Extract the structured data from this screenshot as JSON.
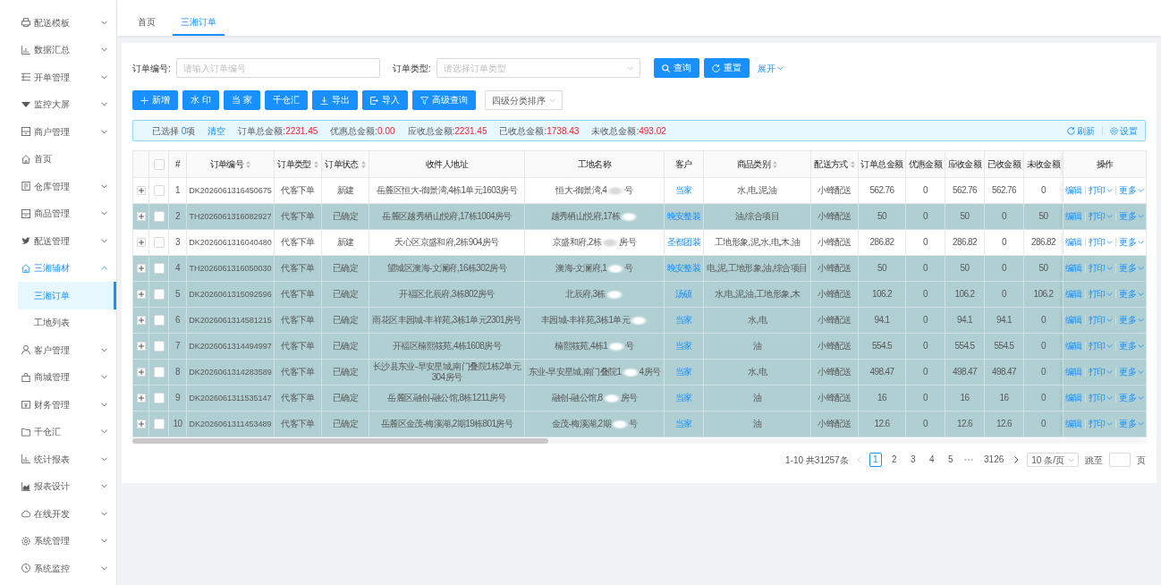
{
  "sidebar": {
    "items": [
      {
        "label": "配送模板",
        "kind": "group",
        "expanded": false,
        "selected": false
      },
      {
        "label": "数据汇总",
        "kind": "group",
        "expanded": false,
        "selected": false
      },
      {
        "label": "开单管理",
        "kind": "group",
        "expanded": false,
        "selected": false
      },
      {
        "label": "监控大屏",
        "kind": "group",
        "expanded": false,
        "selected": false
      },
      {
        "label": "商户管理",
        "kind": "group",
        "expanded": false,
        "selected": false
      },
      {
        "label": "首页",
        "kind": "link",
        "selected": false
      },
      {
        "label": "仓库管理",
        "kind": "group",
        "expanded": false,
        "selected": false
      },
      {
        "label": "商品管理",
        "kind": "group",
        "expanded": false,
        "selected": false
      },
      {
        "label": "配送管理",
        "kind": "group",
        "expanded": false,
        "selected": false
      },
      {
        "label": "三湘辅材",
        "kind": "group",
        "expanded": true,
        "selected": true,
        "children": [
          {
            "label": "三湘订单",
            "selected": true
          },
          {
            "label": "工地列表",
            "selected": false
          }
        ]
      },
      {
        "label": "客户管理",
        "kind": "group",
        "expanded": false,
        "selected": false
      },
      {
        "label": "商城管理",
        "kind": "group",
        "expanded": false,
        "selected": false
      },
      {
        "label": "财务管理",
        "kind": "group",
        "expanded": false,
        "selected": false
      },
      {
        "label": "千仓汇",
        "kind": "group",
        "expanded": false,
        "selected": false
      },
      {
        "label": "统计报表",
        "kind": "group",
        "expanded": false,
        "selected": false
      },
      {
        "label": "报表设计",
        "kind": "group",
        "expanded": false,
        "selected": false
      },
      {
        "label": "在线开发",
        "kind": "group",
        "expanded": false,
        "selected": false
      },
      {
        "label": "系统管理",
        "kind": "group",
        "expanded": false,
        "selected": false
      },
      {
        "label": "系统监控",
        "kind": "group",
        "expanded": false,
        "selected": false
      }
    ]
  },
  "tabs": [
    {
      "label": "首页",
      "selected": false
    },
    {
      "label": "三湘订单",
      "selected": true
    }
  ],
  "filters": {
    "fields": [
      {
        "kind": "input",
        "label": "订单编号:",
        "placeholder": "请输入订单编号"
      },
      {
        "kind": "select",
        "label": "订单类型:",
        "placeholder": "请选择订单类型"
      }
    ],
    "buttons": [
      {
        "kind": "search",
        "label": "查询"
      },
      {
        "kind": "reset",
        "label": "重置"
      }
    ],
    "expand_link": "展开"
  },
  "toolbar": {
    "buttons": [
      {
        "kind": "add",
        "label": "新增"
      },
      {
        "kind": "plain",
        "label": "水 印"
      },
      {
        "kind": "plain",
        "label": "当 家"
      },
      {
        "kind": "plain",
        "label": "千仓汇"
      },
      {
        "kind": "export",
        "label": "导出"
      },
      {
        "kind": "import",
        "label": "导入"
      },
      {
        "kind": "filter",
        "label": "高级查询"
      }
    ],
    "sort_select": {
      "value": "四级分类排序"
    }
  },
  "summary": {
    "selected_label": "已选择",
    "selected_count": "0",
    "selected_unit": "项",
    "clear_link": "清空",
    "totals": [
      {
        "label": "订单总金额:",
        "value": "2231.45"
      },
      {
        "label": "优惠总金额:",
        "value": "0.00"
      },
      {
        "label": "应收总金额:",
        "value": "2231.45"
      },
      {
        "label": "已收总金额:",
        "value": "1738.43"
      },
      {
        "label": "未收总金额:",
        "value": "493.02"
      }
    ],
    "links": [
      {
        "kind": "refresh",
        "label": "刷新"
      },
      {
        "kind": "settings",
        "label": "设置"
      }
    ]
  },
  "table": {
    "select_all": {
      "checked": false
    },
    "columns": [
      {
        "label": "#",
        "sortable": false
      },
      {
        "label": "订单编号",
        "sortable": true
      },
      {
        "label": "订单类型",
        "sortable": true
      },
      {
        "label": "订单状态",
        "sortable": true
      },
      {
        "label": "收件人地址",
        "sortable": false
      },
      {
        "label": "工地名称",
        "sortable": false
      },
      {
        "label": "客户",
        "sortable": false
      },
      {
        "label": "商品类别",
        "sortable": true
      },
      {
        "label": "配送方式",
        "sortable": true
      },
      {
        "label": "订单总金额",
        "sortable": false
      },
      {
        "label": "优惠金额",
        "sortable": false
      },
      {
        "label": "应收金额",
        "sortable": false
      },
      {
        "label": "已收金额",
        "sortable": false
      },
      {
        "label": "未收金额",
        "sortable": false
      },
      {
        "label": "操作",
        "sortable": false
      }
    ],
    "rows": [
      {
        "index": "1",
        "order_no": "DK2026061316450675",
        "type": "代客下单",
        "status": "新建",
        "address": "岳麓区恒大-御景湾,4栋1单元1603房号",
        "site": {
          "text": "恒大-御景湾,4",
          "redacted": true,
          "tail": "号"
        },
        "customer": "当家",
        "category": "水,电,泥,油",
        "delivery": "小蜂配送",
        "total": "562.76",
        "discount": "0",
        "receivable": "562.76",
        "received": "562.76",
        "unreceived": "0",
        "checked": false,
        "highlighted": false,
        "actions": [
          {
            "label": "编辑",
            "menu": false
          },
          {
            "label": "打印",
            "menu": true
          },
          {
            "label": "更多",
            "menu": true
          }
        ]
      },
      {
        "index": "2",
        "order_no": "TH2026061316082927",
        "type": "代客下单",
        "status": "已确定",
        "address": "岳麓区越秀栖山悦府,17栋1004房号",
        "site": {
          "text": "越秀栖山悦府,17栋",
          "redacted": true
        },
        "customer": "晚安整装",
        "category": "油,综合项目",
        "delivery": "小蜂配送",
        "total": "50",
        "discount": "0",
        "receivable": "50",
        "received": "0",
        "unreceived": "50",
        "checked": false,
        "highlighted": true,
        "actions": [
          {
            "label": "编辑",
            "menu": false
          },
          {
            "label": "打印",
            "menu": true
          },
          {
            "label": "更多",
            "menu": true
          }
        ]
      },
      {
        "index": "3",
        "order_no": "DK2026061316040480",
        "type": "代客下单",
        "status": "新建",
        "address": "天心区京盛和府,2栋904房号",
        "site": {
          "text": "京盛和府,2栋",
          "redacted": true,
          "tail": "房号"
        },
        "customer": "圣都团装",
        "category": "工地形象,泥,水,电,木,油",
        "delivery": "小蜂配送",
        "total": "286.82",
        "discount": "0",
        "receivable": "286.82",
        "received": "0",
        "unreceived": "286.82",
        "checked": false,
        "highlighted": false,
        "actions": [
          {
            "label": "编辑",
            "menu": false
          },
          {
            "label": "打印",
            "menu": true
          },
          {
            "label": "更多",
            "menu": true
          }
        ]
      },
      {
        "index": "4",
        "order_no": "TH2026061316050030",
        "type": "代客下单",
        "status": "已确定",
        "address": "望城区澳海-文澜府,16栋302房号",
        "site": {
          "text": "澳海-文澜府,1",
          "redacted": true,
          "tail": "号"
        },
        "customer": "晚安整装",
        "category": "电,泥,工地形象,油,综合项目",
        "delivery": "小蜂配送",
        "total": "50",
        "discount": "0",
        "receivable": "50",
        "received": "0",
        "unreceived": "50",
        "checked": false,
        "highlighted": true,
        "actions": [
          {
            "label": "编辑",
            "menu": false
          },
          {
            "label": "打印",
            "menu": true
          },
          {
            "label": "更多",
            "menu": true
          }
        ]
      },
      {
        "index": "5",
        "order_no": "DK2026061315092596",
        "type": "代客下单",
        "status": "已确定",
        "address": "开福区北辰府,3栋802房号",
        "site": {
          "text": "北辰府,3栋",
          "redacted": true
        },
        "customer": "汤硕",
        "category": "水,电,泥,油,工地形象,木",
        "delivery": "小蜂配送",
        "total": "106.2",
        "discount": "0",
        "receivable": "106.2",
        "received": "0",
        "unreceived": "106.2",
        "checked": false,
        "highlighted": true,
        "actions": [
          {
            "label": "编辑",
            "menu": false
          },
          {
            "label": "打印",
            "menu": true
          },
          {
            "label": "更多",
            "menu": true
          }
        ]
      },
      {
        "index": "6",
        "order_no": "DK2026061314581215",
        "type": "代客下单",
        "status": "已确定",
        "address": "雨花区丰园城-丰祥苑,3栋1单元2301房号",
        "site": {
          "text": "丰园城-丰祥苑,3栋1单元",
          "redacted": true
        },
        "customer": "当家",
        "category": "水,电",
        "delivery": "小蜂配送",
        "total": "94.1",
        "discount": "0",
        "receivable": "94.1",
        "received": "94.1",
        "unreceived": "0",
        "checked": false,
        "highlighted": true,
        "actions": [
          {
            "label": "编辑",
            "menu": false
          },
          {
            "label": "打印",
            "menu": true
          },
          {
            "label": "更多",
            "menu": true
          }
        ]
      },
      {
        "index": "7",
        "order_no": "DK2026061314494997",
        "type": "代客下单",
        "status": "已确定",
        "address": "开福区楠熙筱苑,4栋1608房号",
        "site": {
          "text": "楠熙筱苑,4栋1",
          "redacted": true,
          "tail": "号"
        },
        "customer": "当家",
        "category": "油",
        "delivery": "小蜂配送",
        "total": "554.5",
        "discount": "0",
        "receivable": "554.5",
        "received": "554.5",
        "unreceived": "0",
        "checked": false,
        "highlighted": true,
        "actions": [
          {
            "label": "编辑",
            "menu": false
          },
          {
            "label": "打印",
            "menu": true
          },
          {
            "label": "更多",
            "menu": true
          }
        ]
      },
      {
        "index": "8",
        "order_no": "DK2026061314283589",
        "type": "代客下单",
        "status": "已确定",
        "address": "长沙县东业-早安星城,南门叠院1栋2单元304房号",
        "site": {
          "text": "东业-早安星城,南门叠院1",
          "redacted": true,
          "tail": "4房号"
        },
        "customer": "当家",
        "category": "水,电",
        "delivery": "小蜂配送",
        "total": "498.47",
        "discount": "0",
        "receivable": "498.47",
        "received": "498.47",
        "unreceived": "0",
        "checked": false,
        "highlighted": true,
        "actions": [
          {
            "label": "编辑",
            "menu": false
          },
          {
            "label": "打印",
            "menu": true
          },
          {
            "label": "更多",
            "menu": true
          }
        ]
      },
      {
        "index": "9",
        "order_no": "DK2026061311535147",
        "type": "代客下单",
        "status": "已确定",
        "address": "岳麓区融创-融公馆,8栋1211房号",
        "site": {
          "text": "融创-融公馆,8",
          "redacted": true,
          "tail": "房号"
        },
        "customer": "当家",
        "category": "油",
        "delivery": "小蜂配送",
        "total": "16",
        "discount": "0",
        "receivable": "16",
        "received": "16",
        "unreceived": "0",
        "checked": false,
        "highlighted": true,
        "actions": [
          {
            "label": "编辑",
            "menu": false
          },
          {
            "label": "打印",
            "menu": true
          },
          {
            "label": "更多",
            "menu": true
          }
        ]
      },
      {
        "index": "10",
        "order_no": "DK2026061311453489",
        "type": "代客下单",
        "status": "已确定",
        "address": "岳麓区金茂-梅溪湖,2期19栋801房号",
        "site": {
          "text": "金茂-梅溪湖,2期",
          "redacted": true,
          "tail": "号"
        },
        "customer": "当家",
        "category": "油",
        "delivery": "小蜂配送",
        "total": "12.6",
        "discount": "0",
        "receivable": "12.6",
        "received": "12.6",
        "unreceived": "0",
        "checked": false,
        "highlighted": true,
        "actions": [
          {
            "label": "编辑",
            "menu": false
          },
          {
            "label": "打印",
            "menu": true
          },
          {
            "label": "更多",
            "menu": true
          }
        ]
      }
    ]
  },
  "pagination": {
    "summary": "1-10 共31257条",
    "previous": {
      "disabled": true
    },
    "pages": [
      {
        "kind": "page",
        "label": "1",
        "selected": true
      },
      {
        "kind": "page",
        "label": "2",
        "selected": false
      },
      {
        "kind": "page",
        "label": "3",
        "selected": false
      },
      {
        "kind": "page",
        "label": "4",
        "selected": false
      },
      {
        "kind": "page",
        "label": "5",
        "selected": false
      },
      {
        "kind": "ellipsis",
        "label": "•••",
        "selected": false
      },
      {
        "kind": "page",
        "label": "3126",
        "selected": false
      }
    ],
    "next": {
      "disabled": false
    },
    "page_size": "10 条/页",
    "jump_label": "跳至",
    "jump_unit": "页"
  }
}
